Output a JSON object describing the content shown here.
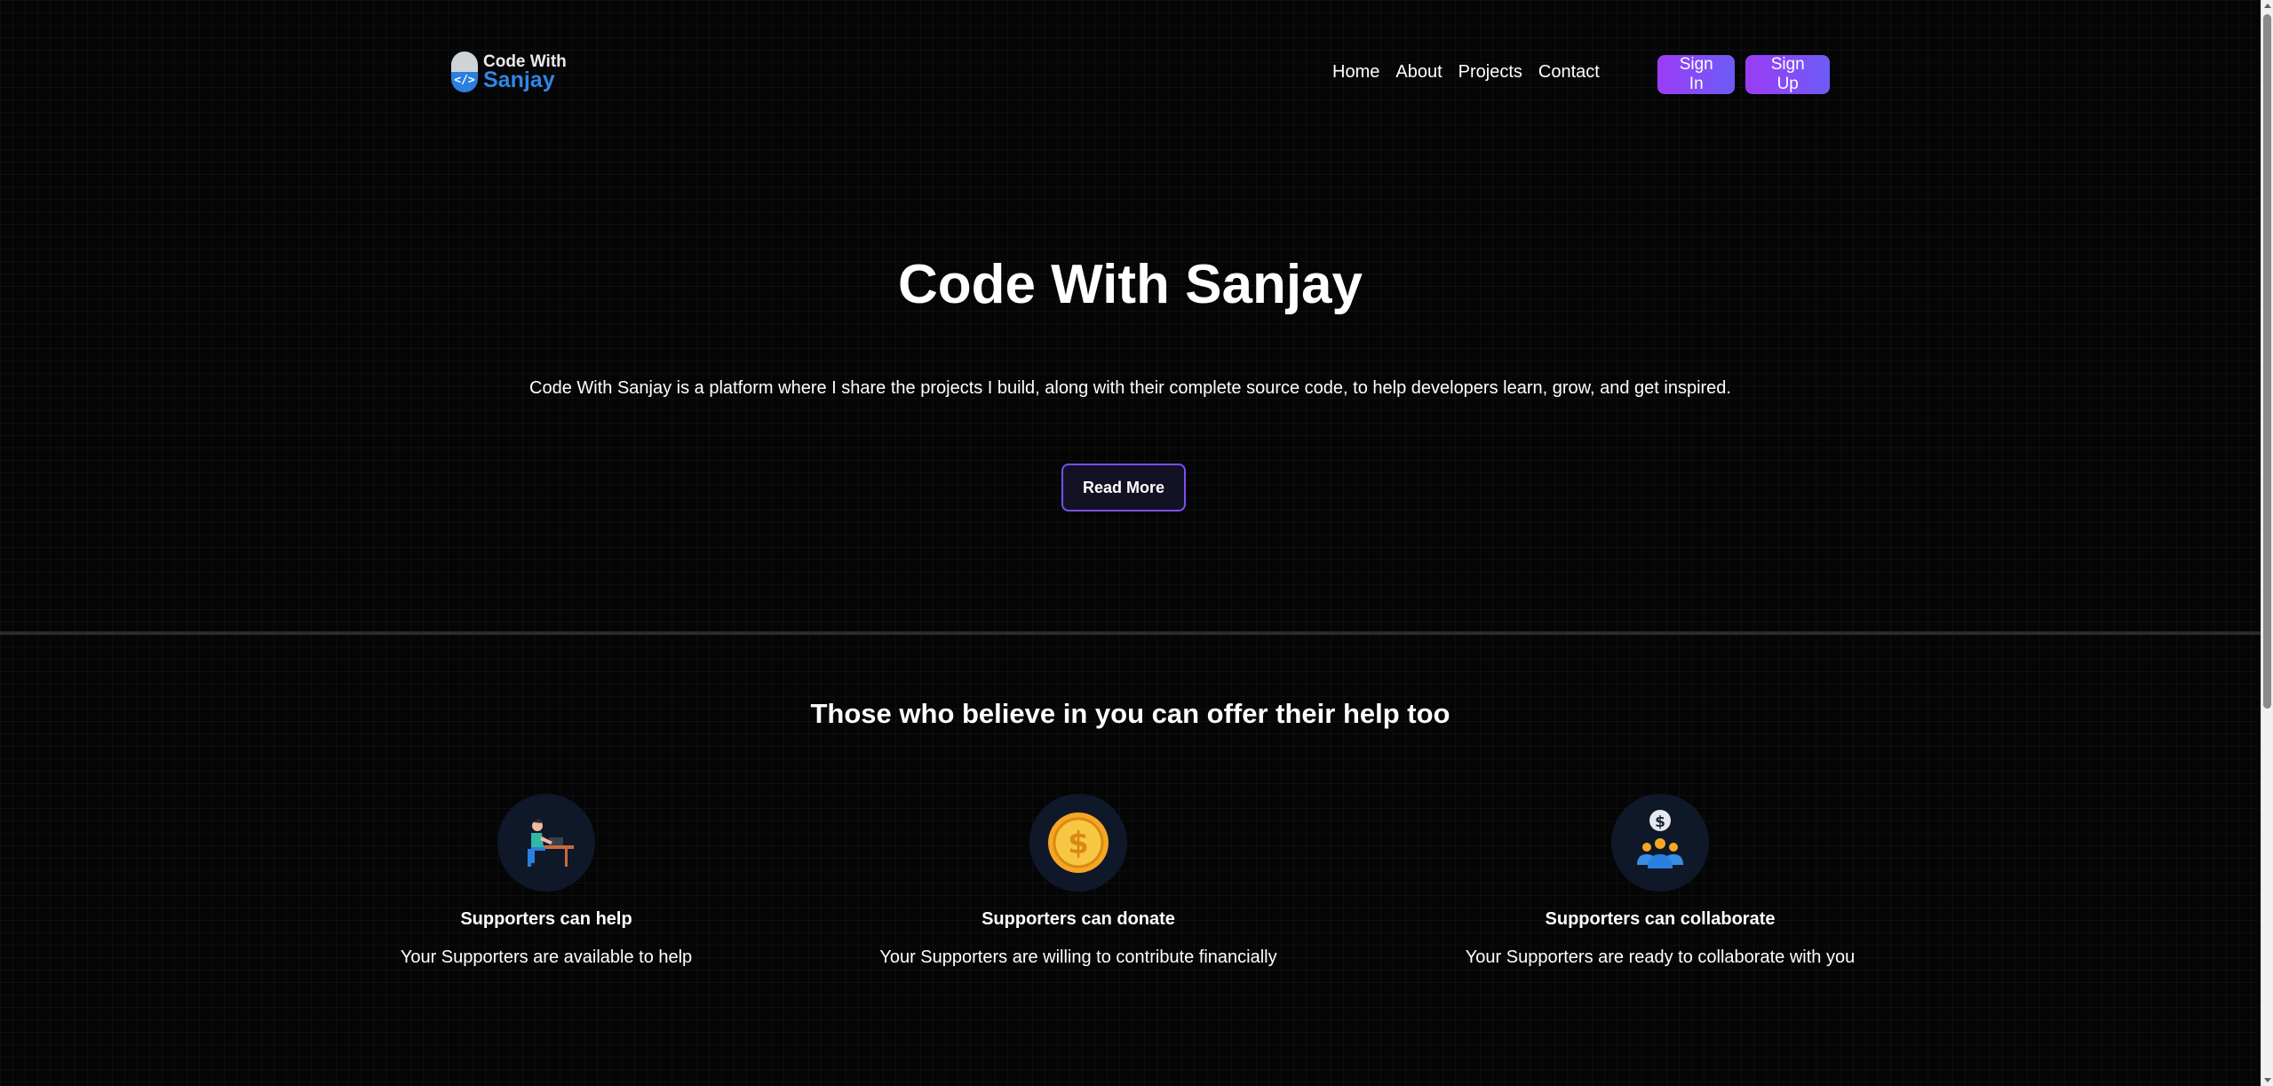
{
  "brand": {
    "line1": "Code With",
    "line2": "Sanjay",
    "icon_glyph": "</>"
  },
  "nav": {
    "links": [
      "Home",
      "About",
      "Projects",
      "Contact"
    ],
    "sign_in": "Sign In",
    "sign_up": "Sign Up"
  },
  "hero": {
    "title": "Code With Sanjay",
    "description": "Code With Sanjay is a platform where I share the projects I build, along with their complete source code, to help developers learn, grow, and get inspired.",
    "cta": "Read More"
  },
  "supporters": {
    "heading": "Those who believe in you can offer their help too",
    "items": [
      {
        "icon": "person-at-desk-icon",
        "title": "Supporters can help",
        "desc": "Your Supporters are available to help"
      },
      {
        "icon": "gold-coin-icon",
        "title": "Supporters can donate",
        "desc": "Your Supporters are willing to contribute financially"
      },
      {
        "icon": "group-dollar-icon",
        "title": "Supporters can collaborate",
        "desc": "Your Supporters are ready to collaborate with you"
      }
    ]
  },
  "colors": {
    "background": "#050506",
    "accent_start": "#9b3cf5",
    "accent_end": "#6d5cf7",
    "brand_blue": "#2f86e6",
    "icon_circle": "#0f1829"
  }
}
